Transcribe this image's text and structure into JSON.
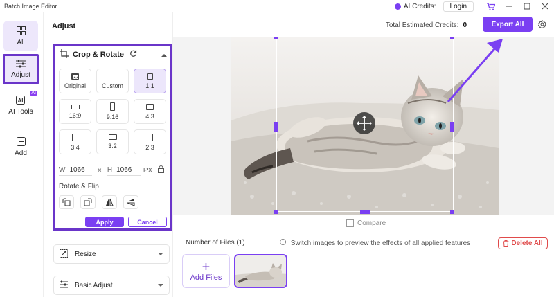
{
  "titlebar": {
    "app_title": "Batch Image Editor",
    "ai_credits_label": "AI Credits:",
    "login_label": "Login"
  },
  "leftnav": {
    "items": [
      {
        "label": "All",
        "icon": "grid-icon"
      },
      {
        "label": "Adjust",
        "icon": "sliders-icon"
      },
      {
        "label": "AI Tools",
        "icon": "ai-icon",
        "badge": "AI"
      },
      {
        "label": "Add",
        "icon": "plus-square-icon"
      }
    ]
  },
  "panel": {
    "title": "Adjust",
    "crop": {
      "label": "Crop & Rotate",
      "ratios": [
        "Original",
        "Custom",
        "1:1",
        "16:9",
        "9:16",
        "4:3",
        "3:4",
        "3:2",
        "2:3"
      ],
      "selected_ratio": "1:1",
      "width_key": "W",
      "width_value": "1066",
      "times": "×",
      "height_key": "H",
      "height_value": "1066",
      "unit": "PX",
      "rotate_flip_label": "Rotate & Flip",
      "apply_label": "Apply",
      "cancel_label": "Cancel"
    },
    "resize_label": "Resize",
    "basic_adjust_label": "Basic Adjust"
  },
  "main": {
    "credits_label": "Total Estimated Credits:",
    "credits_value": "0",
    "export_label": "Export All",
    "compare_label": "Compare",
    "files_count": "Number of Files (1)",
    "hint": "Switch images to preview the effects of all applied features",
    "delete_all_label": "Delete All",
    "add_files_label": "Add Files"
  },
  "colors": {
    "accent": "#7a3ff2",
    "highlight_border": "#6a35c9",
    "danger": "#e04b4b"
  }
}
